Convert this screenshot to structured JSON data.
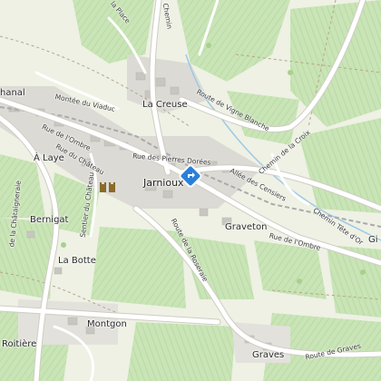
{
  "map": {
    "town": "Jarnioux",
    "places": {
      "la_creuse": "La Creuse",
      "a_laye": "À Laye",
      "bernigat": "Bernigat",
      "la_botte": "La Botte",
      "montgon": "Montgon",
      "roitiere": "Roitière",
      "graveton": "Graveton",
      "graves": "Graves",
      "chanal": "hanal",
      "gi": "Gi"
    },
    "roads": {
      "rue_ombre_w": "Rue de l'Ombre",
      "rue_ombre_e": "Rue de l'Ombre",
      "rue_chateau": "Rue du Château",
      "sentier_chateau": "Sentier du Château",
      "montee_viaduc": "Montée du Viaduc",
      "pierres_dorees": "Rue des Pierres Dorées",
      "vigne_blanche": "Route de Vigne Blanche",
      "chemin_croix": "Chemin de la Croix",
      "allee_censiers": "Allée des Censiers",
      "chemin_tete": "Chemin Tête d'Or",
      "route_roseraie": "Route de la Roseraie",
      "route_graves": "Route de Graves",
      "la_place": "la Place",
      "chataigneraie": "de la Châtaigneraie",
      "chemin_n": "Chemin"
    },
    "colors": {
      "vineyard": "#c7e3b4",
      "field": "#e4ecd2",
      "built": "#d9d7d2",
      "road": "#ffffff",
      "marker": "#2b7fd8"
    },
    "icons": {
      "location_marker": "location-pin-icon",
      "castle_poi": "castle-icon"
    }
  }
}
